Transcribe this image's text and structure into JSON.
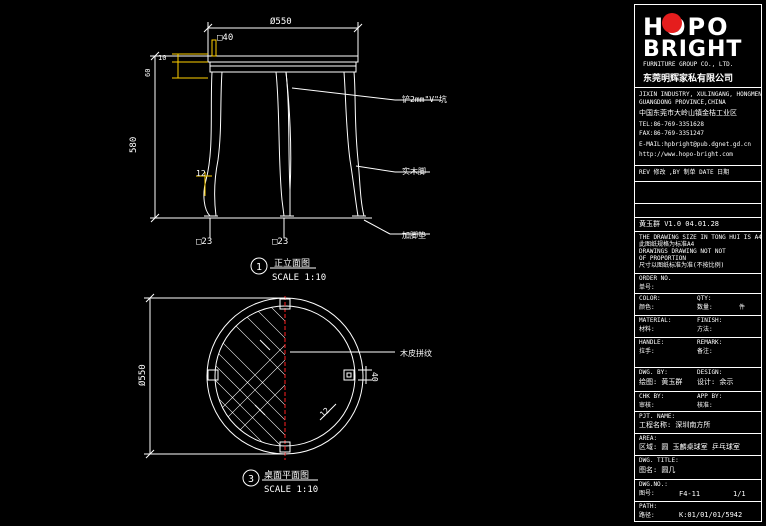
{
  "drawing": {
    "front_view": {
      "overall_width": "Ø550",
      "leg_width_top": "□40",
      "top_thickness_1": "10",
      "top_thickness_2": "60",
      "height": "580",
      "leg_gap": "12",
      "leg_bottom_left": "□23",
      "leg_bottom_middle": "□23",
      "callout_groove": "铲2mm\"V\"坑",
      "callout_wood": "实木脚",
      "callout_foot": "加脚垫",
      "view_number": "1",
      "view_title": "正立面图",
      "view_scale": "SCALE 1:10"
    },
    "plan_view": {
      "diameter": "Ø550",
      "leg_size": "40",
      "edge_dim": "12",
      "callout_veneer": "木皮拼纹",
      "view_number": "3",
      "view_title": "桌面平面图",
      "view_scale": "SCALE 1:10"
    }
  },
  "titleblock": {
    "logo_line1": "HOPO",
    "logo_line2": "BRIGHT",
    "logo_sub": "FURNITURE GROUP CO., LTD.",
    "logo_cn": "东莞明辉家私有限公司",
    "addr_1": "JIXIN INDUSTRY, XULINGANG, HONGMEN",
    "addr_2": "GUANGDONG PROVINCE,CHINA",
    "addr_cn": "中国东莞市大岭山镇金桔工业区",
    "tel": "TEL:86-769-3351628",
    "fax": "FAX:86-769-3351247",
    "email": "E-MAIL:hpbright@pub.dgnet.gd.cn",
    "web": "http://www.hopo-bright.com",
    "rev_header": "REV 修改  ,BY 制单  DATE 日期",
    "rev_row": "黄玉群    V1.0   04.01.28",
    "note_1": "THE DRAWING SIZE IN TONG HUI IS A4",
    "note_2": "此图纸规格为标准A4",
    "note_3": "DRAWINGS DRAWING NOT NOT",
    "note_4": "OF PROPORTION",
    "note_5": "尺寸以图纸标准为准(不按比例)",
    "order_label": "ORDER NO.",
    "order_cn": "单号:",
    "color_label": "COLOR:",
    "qty_label": "QTY:",
    "color_cn": "颜色:",
    "qty_cn": "数量:",
    "qty_unit": "件",
    "material_label": "MATERIAL:",
    "finish_label": "FINISH:",
    "material_cn": "材料:",
    "finish_cn": "方法:",
    "handle_label": "HANDLE:",
    "remark_label": "REMARK:",
    "handle_cn": "拉手:",
    "remark_cn": "备注:",
    "drawn_label": "DWG. BY:",
    "design_label": "DESIGN:",
    "drawn_cn": "绘图: 黄玉群",
    "design_cn": "设计:  余示",
    "chk_label": "CHK BY:",
    "app_label": "APP BY:",
    "chk_cn": "审核:",
    "app_cn": "核准:",
    "prj_label": "PJT. NAME:",
    "prj_cn": "工程名称:  深圳南方所",
    "area_label": "AREA:",
    "area_cn": "区域: 圆 玉麟桌球室 乒乓球室",
    "title_label": "DWG. TITLE:",
    "title_cn": "图名:   圆几",
    "no_label": "DWG.NO.:",
    "no_cn": "图号:",
    "no_value": "F4-11",
    "page_value": "1/1",
    "path_label": "PATH:",
    "path_cn": "路径:",
    "path_value": "K:01/01/01/5942"
  }
}
